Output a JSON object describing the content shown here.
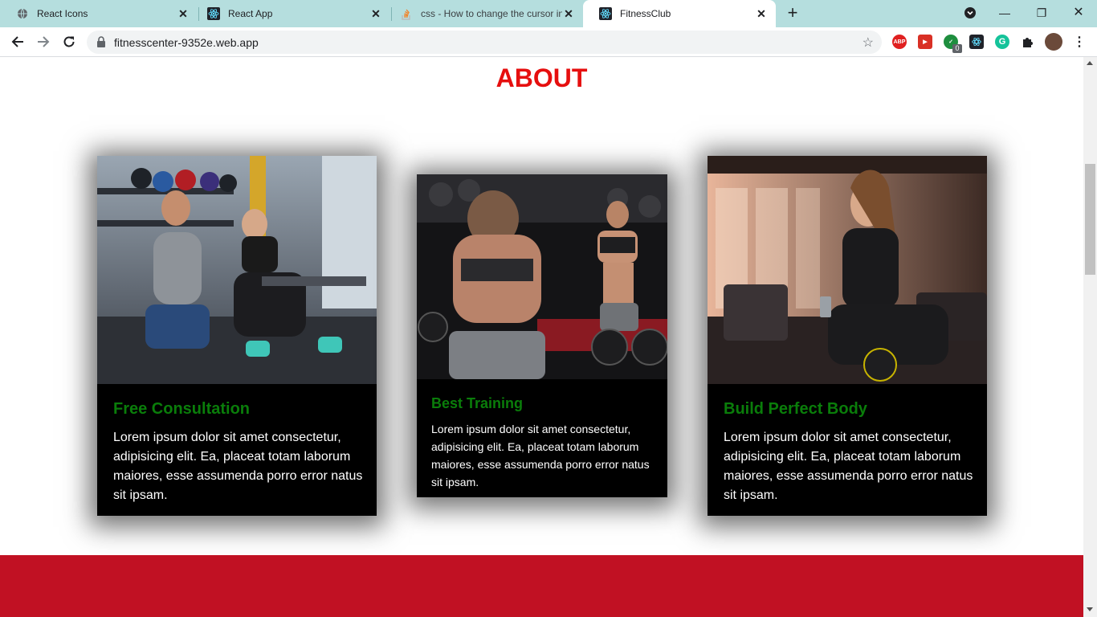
{
  "browser": {
    "tabs": [
      {
        "title": "React Icons",
        "favicon": "globe-icon"
      },
      {
        "title": "React App",
        "favicon": "react-icon"
      },
      {
        "title": "css - How to change the cursor in",
        "favicon": "stackoverflow-icon"
      },
      {
        "title": "FitnessClub",
        "favicon": "react-icon",
        "active": true
      }
    ],
    "url": "fitnesscenter-9352e.web.app",
    "extension_badge": "0"
  },
  "about": {
    "title": "ABOUT",
    "cards": [
      {
        "heading": "Free Consultation",
        "text": "Lorem ipsum dolor sit amet consectetur, adipisicing elit. Ea, placeat totam laborum maiores, esse assumenda porro error natus sit ipsam."
      },
      {
        "heading": "Best Training",
        "text": "Lorem ipsum dolor sit amet consectetur, adipisicing elit. Ea, placeat totam laborum maiores, esse assumenda porro error natus sit ipsam."
      },
      {
        "heading": "Build Perfect Body",
        "text": "Lorem ipsum dolor sit amet consectetur, adipisicing elit. Ea, placeat totam laborum maiores, esse assumenda porro error natus sit ipsam."
      }
    ]
  },
  "colors": {
    "about_title": "#e60f0f",
    "card_heading": "#0a7d0a",
    "card_bg": "#000000",
    "red_band": "#c11123"
  }
}
